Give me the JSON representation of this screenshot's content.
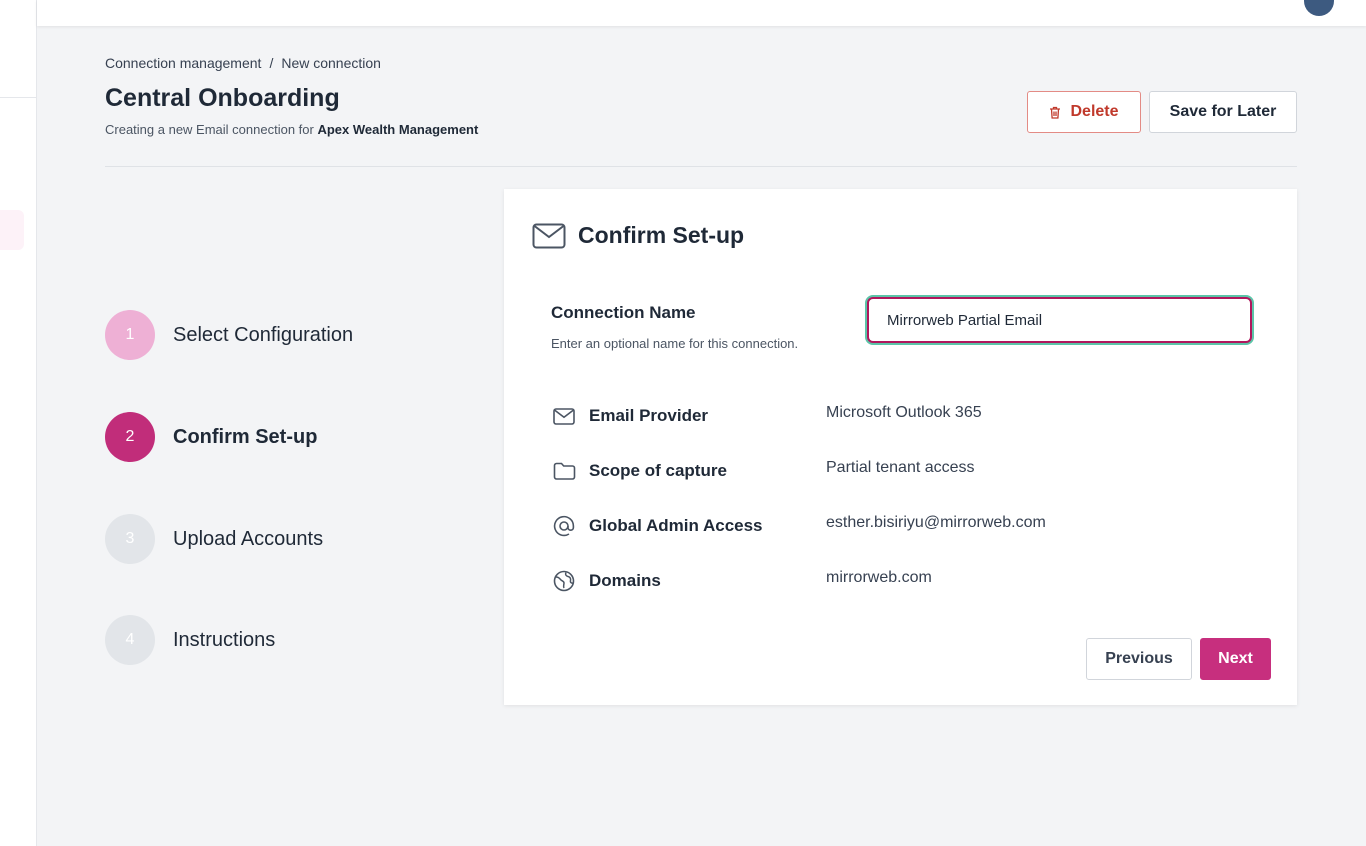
{
  "breadcrumb": {
    "parent": "Connection management",
    "separator": "/",
    "current": "New connection"
  },
  "page": {
    "title": "Central Onboarding",
    "subtitle_prefix": "Creating a new Email connection for",
    "subtitle_org": "Apex Wealth Management"
  },
  "actions": {
    "delete_label": "Delete",
    "save_label": "Save for Later"
  },
  "steps": [
    {
      "number": "1",
      "label": "Select Configuration",
      "state": "completed"
    },
    {
      "number": "2",
      "label": "Confirm Set-up",
      "state": "active"
    },
    {
      "number": "3",
      "label": "Upload Accounts",
      "state": "pending"
    },
    {
      "number": "4",
      "label": "Instructions",
      "state": "pending"
    }
  ],
  "card": {
    "title": "Confirm Set-up",
    "title_icon": "mail-icon",
    "connection_name": {
      "label": "Connection Name",
      "help": "Enter an optional name for this connection.",
      "value": "Mirrorweb Partial Email"
    },
    "details": [
      {
        "icon": "mail-icon",
        "label": "Email Provider",
        "value": "Microsoft Outlook 365"
      },
      {
        "icon": "folder-icon",
        "label": "Scope of capture",
        "value": "Partial tenant access"
      },
      {
        "icon": "at-sign-icon",
        "label": "Global Admin Access",
        "value": "esther.bisiriyu@mirrorweb.com"
      },
      {
        "icon": "globe-icon",
        "label": "Domains",
        "value": "mirrorweb.com"
      }
    ],
    "previous_label": "Previous",
    "next_label": "Next"
  },
  "colors": {
    "accent": "#c72f7e",
    "step_completed": "#eeb0d5",
    "step_pending": "#e2e5e9",
    "danger": "#c0392b",
    "focus_ring": "#5cc4a8"
  }
}
